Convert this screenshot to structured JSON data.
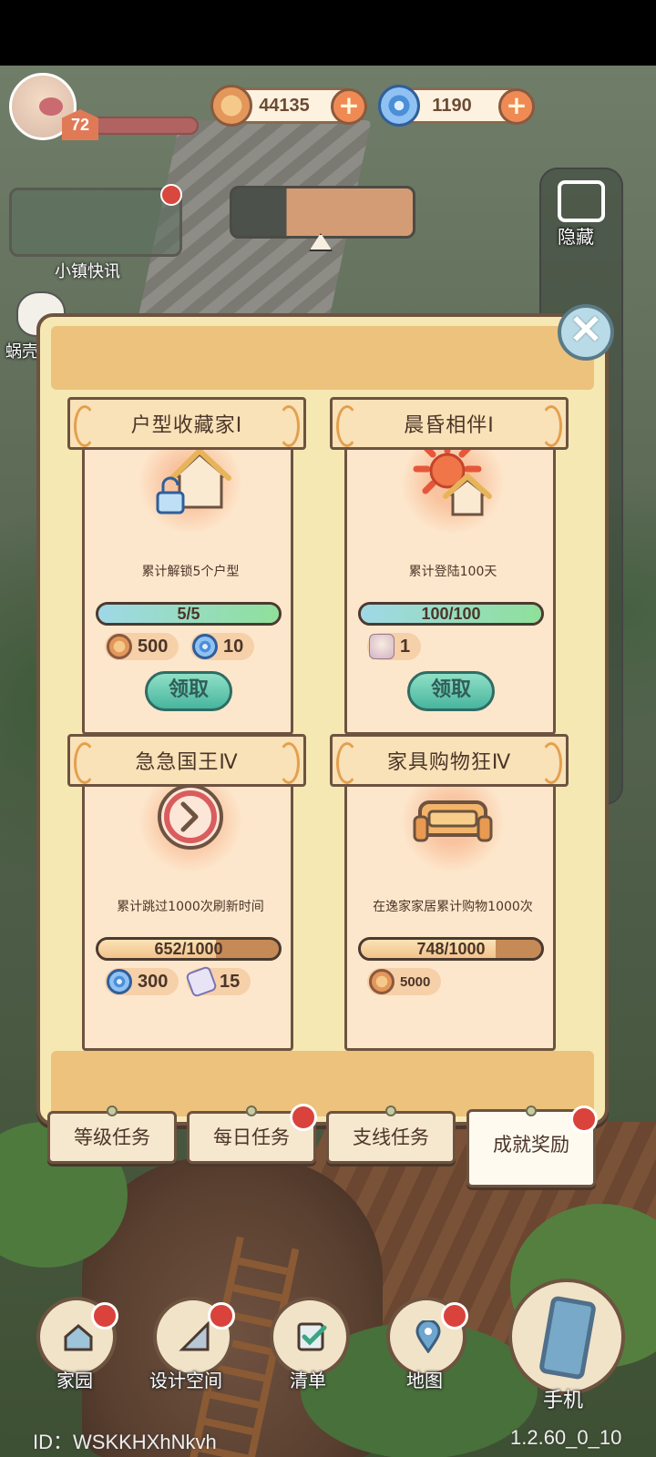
{
  "hud": {
    "level": "72",
    "coins": "44135",
    "gems": "1190",
    "news_label": "小镇快讯",
    "side_hide_label": "隐藏",
    "cat_label": "蜗壳"
  },
  "achievements": [
    {
      "title": "户型收藏家Ⅰ",
      "description": "累计解锁5个户型",
      "progress_text": "5/5",
      "progress_fraction": 1.0,
      "rewards": [
        {
          "icon": "coin-icon",
          "value": "500"
        },
        {
          "icon": "swirl-icon",
          "value": "10"
        }
      ],
      "button_label": "领取"
    },
    {
      "title": "晨昏相伴Ⅰ",
      "description": "累计登陆100天",
      "progress_text": "100/100",
      "progress_fraction": 1.0,
      "rewards": [
        {
          "icon": "avatar-frame-icon",
          "value": "1"
        }
      ],
      "button_label": "领取"
    },
    {
      "title": "急急国王Ⅳ",
      "description": "累计跳过1000次刷新时间",
      "progress_text": "652/1000",
      "progress_fraction": 0.652,
      "rewards": [
        {
          "icon": "swirl-icon",
          "value": "300"
        },
        {
          "icon": "ticket-icon",
          "value": "15"
        }
      ],
      "button_label": ""
    },
    {
      "title": "家具购物狂Ⅳ",
      "description": "在逸家家居累计购物1000次",
      "progress_text": "748/1000",
      "progress_fraction": 0.748,
      "rewards": [
        {
          "icon": "coin-icon",
          "value": "5000"
        }
      ],
      "button_label": ""
    }
  ],
  "tabs": [
    {
      "label": "等级任务",
      "active": false,
      "badge": false
    },
    {
      "label": "每日任务",
      "active": false,
      "badge": true
    },
    {
      "label": "支线任务",
      "active": false,
      "badge": false
    },
    {
      "label": "成就奖励",
      "active": true,
      "badge": true
    }
  ],
  "nav": {
    "home": "家园",
    "design": "设计空间",
    "checklist": "清单",
    "map": "地图",
    "phone": "手机"
  },
  "footer": {
    "id_text": "ID：WSKKHXhNkvh",
    "version": "1.2.60_0_10"
  },
  "colors": {
    "modal_bg": "#f6e8b2",
    "card_bg": "#fde7cc",
    "claim_green": "#48b59e",
    "alert_red": "#d9433c"
  }
}
